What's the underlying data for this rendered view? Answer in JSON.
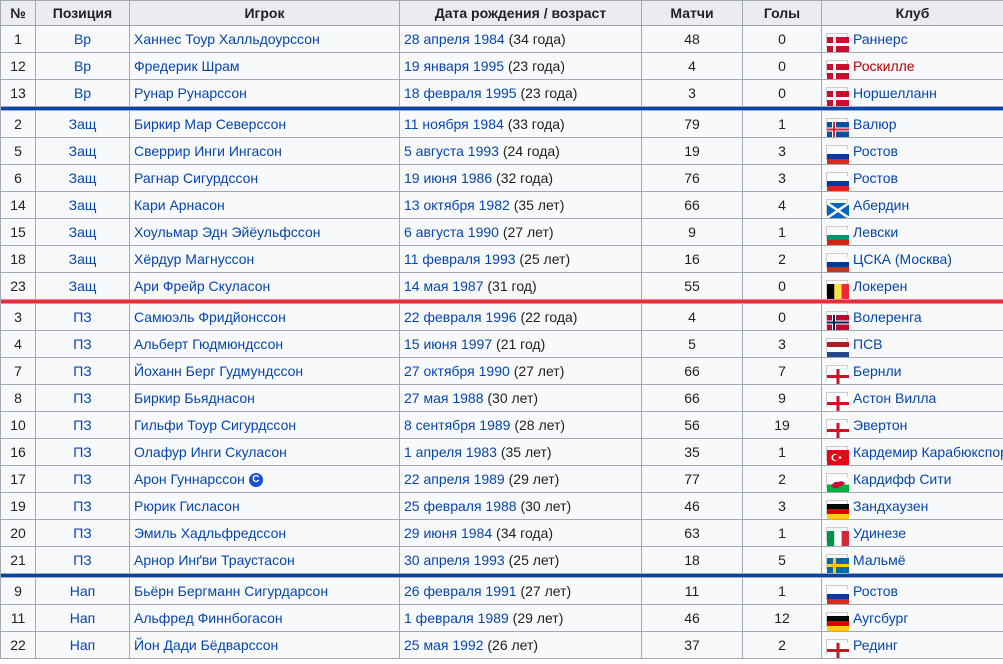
{
  "headers": {
    "num": "№",
    "position": "Позиция",
    "player": "Игрок",
    "dob": "Дата рождения / возраст",
    "caps": "Матчи",
    "goals": "Голы",
    "club": "Клуб"
  },
  "colors": {
    "gk": "#0645ad",
    "df": "#0645ad",
    "mf": "#d33",
    "fw": "#0645ad",
    "link": "#0645ad",
    "redlink": "#ba0000"
  },
  "rows": [
    {
      "num": "1",
      "pos": "Вр",
      "name": "Ханнес Тоур Халльдоурссон",
      "date": "28 апреля 1984",
      "age": "(34 года)",
      "caps": "48",
      "goals": "0",
      "flag": "denmark",
      "club": "Раннерс",
      "club_red": false,
      "captain": false
    },
    {
      "num": "12",
      "pos": "Вр",
      "name": "Фредерик Шрам",
      "date": "19 января 1995",
      "age": "(23 года)",
      "caps": "4",
      "goals": "0",
      "flag": "denmark",
      "club": "Роскилле",
      "club_red": true,
      "captain": false
    },
    {
      "num": "13",
      "pos": "Вр",
      "name": "Рунар Рунарссон",
      "date": "18 февраля 1995",
      "age": "(23 года)",
      "caps": "3",
      "goals": "0",
      "flag": "denmark",
      "club": "Норшелланн",
      "club_red": false,
      "captain": false,
      "sep_after": "#0645ad"
    },
    {
      "num": "2",
      "pos": "Защ",
      "name": "Биркир Мар Северссон",
      "date": "11 ноября 1984",
      "age": "(33 года)",
      "caps": "79",
      "goals": "1",
      "flag": "iceland",
      "club": "Валюр",
      "club_red": false,
      "captain": false
    },
    {
      "num": "5",
      "pos": "Защ",
      "name": "Сверрир Инги Ингасон",
      "date": "5 августа 1993",
      "age": "(24 года)",
      "caps": "19",
      "goals": "3",
      "flag": "russia",
      "club": "Ростов",
      "club_red": false,
      "captain": false
    },
    {
      "num": "6",
      "pos": "Защ",
      "name": "Рагнар Сигурдссон",
      "date": "19 июня 1986",
      "age": "(32 года)",
      "caps": "76",
      "goals": "3",
      "flag": "russia",
      "club": "Ростов",
      "club_red": false,
      "captain": false
    },
    {
      "num": "14",
      "pos": "Защ",
      "name": "Кари Арнасон",
      "date": "13 октября 1982",
      "age": "(35 лет)",
      "caps": "66",
      "goals": "4",
      "flag": "scotland",
      "club": "Абердин",
      "club_red": false,
      "captain": false
    },
    {
      "num": "15",
      "pos": "Защ",
      "name": "Хоульмар Эдн Эйёульфссон",
      "date": "6 августа 1990",
      "age": "(27 лет)",
      "caps": "9",
      "goals": "1",
      "flag": "bulgaria",
      "club": "Левски",
      "club_red": false,
      "captain": false
    },
    {
      "num": "18",
      "pos": "Защ",
      "name": "Хёрдур Магнуссон",
      "date": "11 февраля 1993",
      "age": "(25 лет)",
      "caps": "16",
      "goals": "2",
      "flag": "russia",
      "club": "ЦСКА (Москва)",
      "club_red": false,
      "captain": false
    },
    {
      "num": "23",
      "pos": "Защ",
      "name": "Ари Фрейр Скуласон",
      "date": "14 мая 1987",
      "age": "(31 год)",
      "caps": "55",
      "goals": "0",
      "flag": "belgium",
      "club": "Локерен",
      "club_red": false,
      "captain": false,
      "sep_after": "#d33"
    },
    {
      "num": "3",
      "pos": "ПЗ",
      "name": "Самюэль Фридйонссон",
      "date": "22 февраля 1996",
      "age": "(22 года)",
      "caps": "4",
      "goals": "0",
      "flag": "norway",
      "club": "Волеренга",
      "club_red": false,
      "captain": false
    },
    {
      "num": "4",
      "pos": "ПЗ",
      "name": "Альберт Гюдмюндссон",
      "date": "15 июня 1997",
      "age": "(21 год)",
      "caps": "5",
      "goals": "3",
      "flag": "netherlands",
      "club": "ПСВ",
      "club_red": false,
      "captain": false
    },
    {
      "num": "7",
      "pos": "ПЗ",
      "name": "Йоханн Берг Гудмундссон",
      "date": "27 октября 1990",
      "age": "(27 лет)",
      "caps": "66",
      "goals": "7",
      "flag": "england",
      "club": "Бернли",
      "club_red": false,
      "captain": false
    },
    {
      "num": "8",
      "pos": "ПЗ",
      "name": "Биркир Бьяднасон",
      "date": "27 мая 1988",
      "age": "(30 лет)",
      "caps": "66",
      "goals": "9",
      "flag": "england",
      "club": "Астон Вилла",
      "club_red": false,
      "captain": false
    },
    {
      "num": "10",
      "pos": "ПЗ",
      "name": "Гильфи Тоур Сигурдссон",
      "date": "8 сентября 1989",
      "age": "(28 лет)",
      "caps": "56",
      "goals": "19",
      "flag": "england",
      "club": "Эвертон",
      "club_red": false,
      "captain": false
    },
    {
      "num": "16",
      "pos": "ПЗ",
      "name": "Олафур Инги Скуласон",
      "date": "1 апреля 1983",
      "age": "(35 лет)",
      "caps": "35",
      "goals": "1",
      "flag": "turkey",
      "club": "Кардемир Карабюкспор",
      "club_red": false,
      "captain": false
    },
    {
      "num": "17",
      "pos": "ПЗ",
      "name": "Арон Гуннарссон",
      "date": "22 апреля 1989",
      "age": "(29 лет)",
      "caps": "77",
      "goals": "2",
      "flag": "wales",
      "club": "Кардифф Сити",
      "club_red": false,
      "captain": true
    },
    {
      "num": "19",
      "pos": "ПЗ",
      "name": "Рюрик Гисласон",
      "date": "25 февраля 1988",
      "age": "(30 лет)",
      "caps": "46",
      "goals": "3",
      "flag": "germany",
      "club": "Зандхаузен",
      "club_red": false,
      "captain": false
    },
    {
      "num": "20",
      "pos": "ПЗ",
      "name": "Эмиль Хадльфредссон",
      "date": "29 июня 1984",
      "age": "(34 года)",
      "caps": "63",
      "goals": "1",
      "flag": "italy",
      "club": "Удинезе",
      "club_red": false,
      "captain": false
    },
    {
      "num": "21",
      "pos": "ПЗ",
      "name": "Арнор Инґви Траустасон",
      "date": "30 апреля 1993",
      "age": "(25 лет)",
      "caps": "18",
      "goals": "5",
      "flag": "sweden",
      "club": "Мальмё",
      "club_red": false,
      "captain": false,
      "sep_after": "#0645ad"
    },
    {
      "num": "9",
      "pos": "Нап",
      "name": "Бьёрн Бергманн Сигурдарсон",
      "date": "26 февраля 1991",
      "age": "(27 лет)",
      "caps": "11",
      "goals": "1",
      "flag": "russia",
      "club": "Ростов",
      "club_red": false,
      "captain": false
    },
    {
      "num": "11",
      "pos": "Нап",
      "name": "Альфред Финнбогасон",
      "date": "1 февраля 1989",
      "age": "(29 лет)",
      "caps": "46",
      "goals": "12",
      "flag": "germany",
      "club": "Аугсбург",
      "club_red": false,
      "captain": false
    },
    {
      "num": "22",
      "pos": "Нап",
      "name": "Йон Дади Бёдварссон",
      "date": "25 мая 1992",
      "age": "(26 лет)",
      "caps": "37",
      "goals": "2",
      "flag": "england",
      "club": "Рединг",
      "club_red": false,
      "captain": false
    }
  ],
  "captain_mark": "C"
}
